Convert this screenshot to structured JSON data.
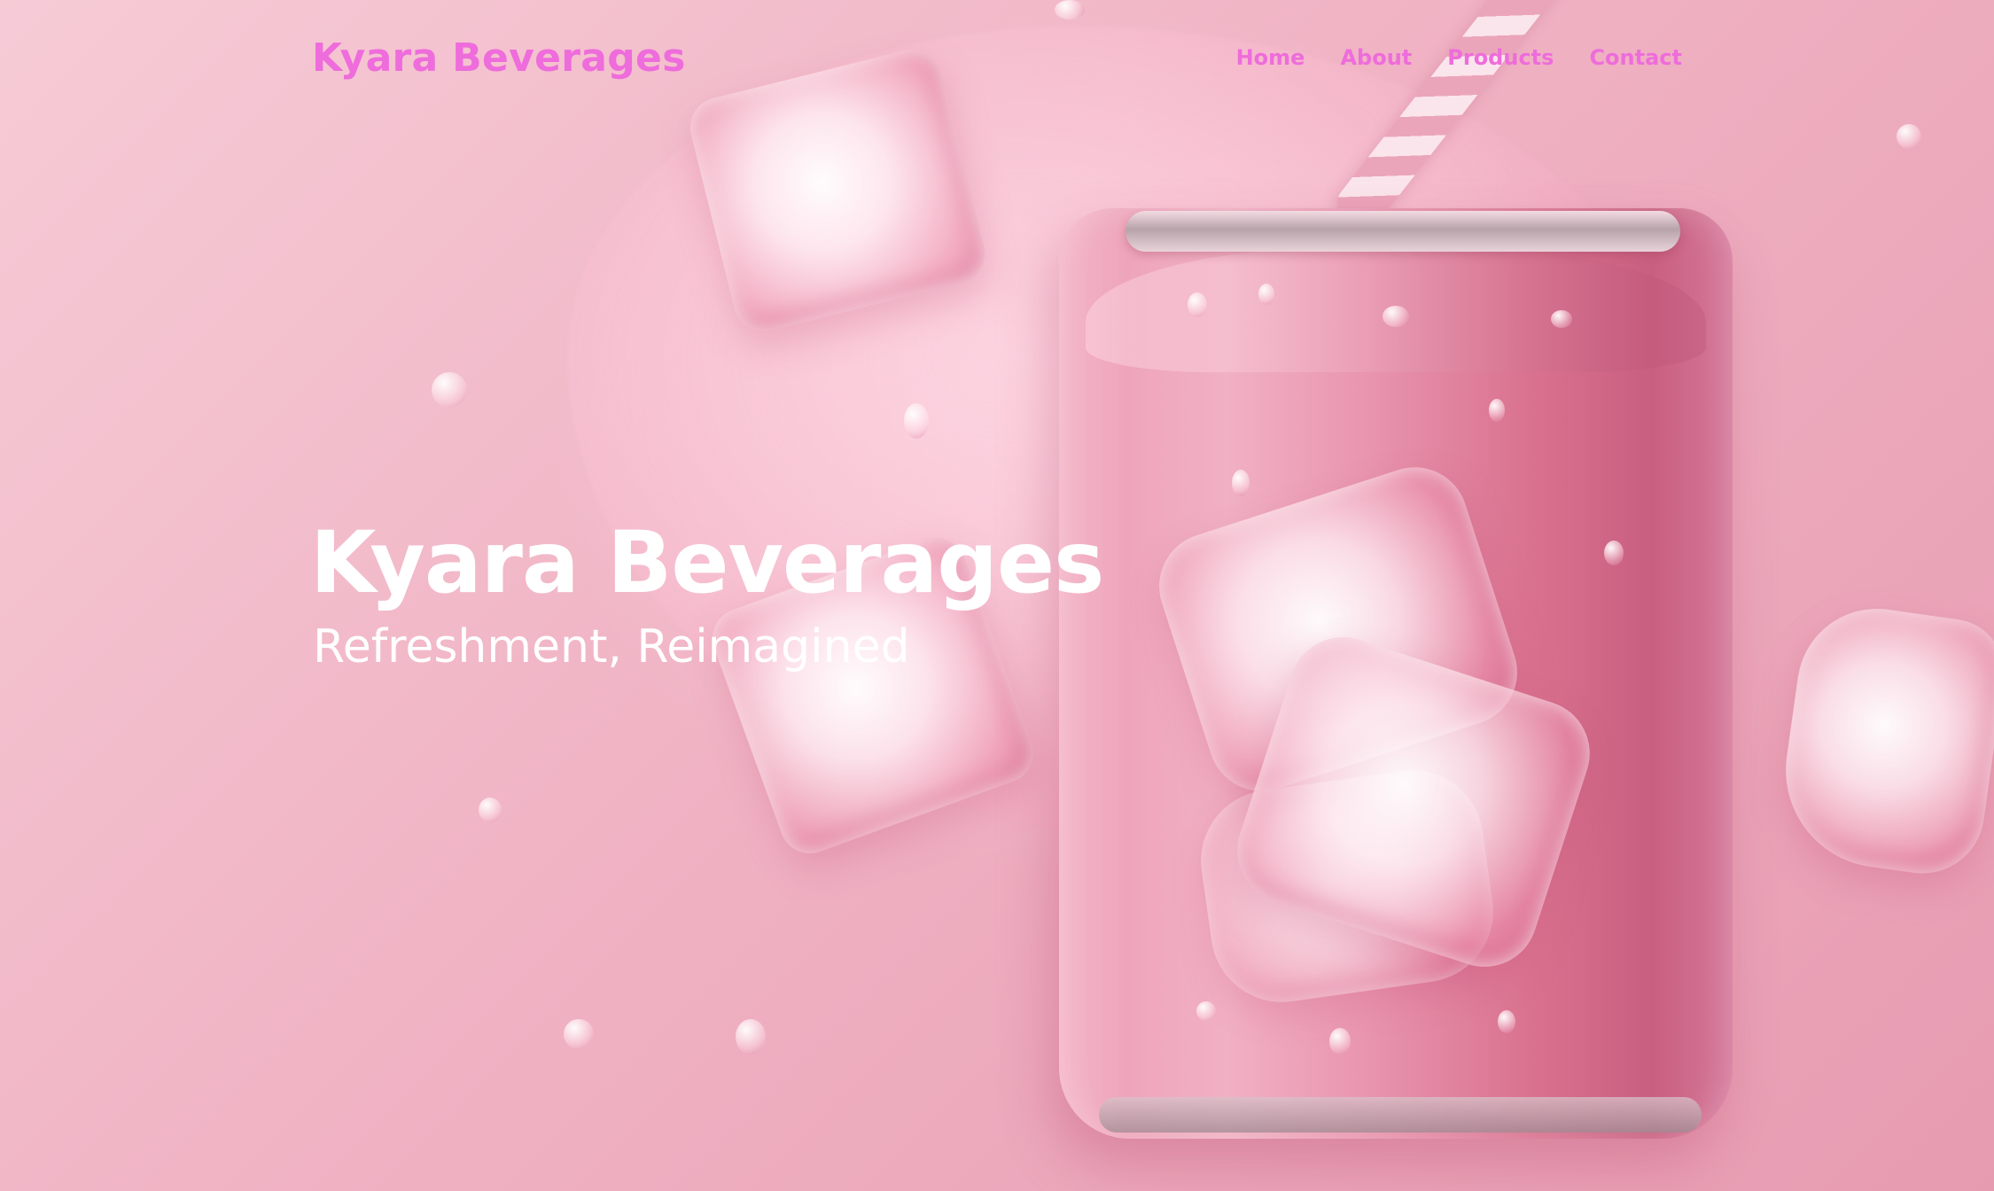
{
  "nav": {
    "brand": "Kyara Beverages",
    "links": [
      {
        "label": "Home"
      },
      {
        "label": "About"
      },
      {
        "label": "Products"
      },
      {
        "label": "Contact"
      }
    ]
  },
  "hero": {
    "title": "Kyara Beverages",
    "subtitle": "Refreshment, Reimagined",
    "background_image": "pink-soda-can-with-ice-cubes-and-straw"
  },
  "colors": {
    "accent": "#ee6cdb",
    "hero_text": "#ffffff",
    "background": "#f2b8c8"
  }
}
